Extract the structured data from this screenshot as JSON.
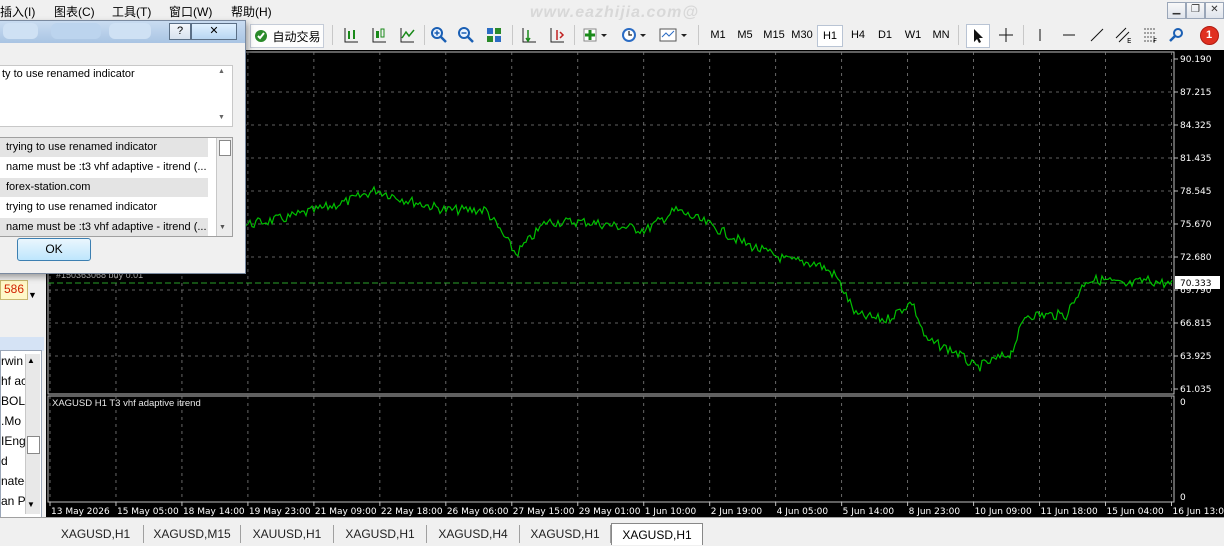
{
  "menu": {
    "items": [
      "插入(I)",
      "图表(C)",
      "工具(T)",
      "窗口(W)",
      "帮助(H)"
    ],
    "watermark": "www.eazhijia.com@"
  },
  "window_controls": {
    "minimize": "▁",
    "restore": "❐",
    "close": "✕"
  },
  "toolbar": {
    "auto_trade_label": "自动交易",
    "timeframes": [
      "M1",
      "M5",
      "M15",
      "M30",
      "H1",
      "H4",
      "D1",
      "W1",
      "MN"
    ],
    "active_timeframe": "H1",
    "notification_count": "1"
  },
  "dialog": {
    "message": "ty to use renamed indicator",
    "rows": [
      "trying to use renamed indicator",
      "name must be :t3 vhf adaptive - itrend (...",
      "forex-station.com",
      "trying to use renamed indicator",
      "name must be :t3 vhf adaptive - itrend (..."
    ],
    "ok_label": "OK",
    "help_label": "?",
    "close_label": "✕"
  },
  "left_panel": {
    "price_value": "586",
    "list_items": [
      "rwin",
      "hf ac",
      "BOL",
      ".Mo",
      "IEng",
      "d",
      "nate-",
      "an P"
    ]
  },
  "chart": {
    "order_label": "#150363068 buy 0.01",
    "indicator_label": "XAGUSD H1 T3 vhf adaptive itrend",
    "price_ticks": [
      "90.190",
      "87.215",
      "84.325",
      "81.435",
      "78.545",
      "75.670",
      "72.680",
      "69.790",
      "66.815",
      "63.925",
      "61.035"
    ],
    "current_price": "70.333",
    "sub_ticks": [
      "0",
      "0"
    ],
    "time_ticks": [
      "13 May 2026",
      "15 May 05:00",
      "18 May 14:00",
      "19 May 23:00",
      "21 May 09:00",
      "22 May 18:00",
      "26 May 06:00",
      "27 May 15:00",
      "29 May 01:00",
      "1 Jun 10:00",
      "2 Jun 19:00",
      "4 Jun 05:00",
      "5 Jun 14:00",
      "8 Jun 23:00",
      "10 Jun 09:00",
      "11 Jun 18:00",
      "15 Jun 04:00",
      "16 Jun 13:00"
    ]
  },
  "tabs": [
    "XAGUSD,H1",
    "XAGUSD,M15",
    "XAUUSD,H1",
    "XAGUSD,H1",
    "XAGUSD,H4",
    "XAGUSD,H1",
    "XAGUSD,H1"
  ],
  "active_tab_index": 6,
  "colors": {
    "price_line": "#00c000",
    "grid": "#808080",
    "background": "#000000",
    "active_price_bg": "#ffffff"
  }
}
